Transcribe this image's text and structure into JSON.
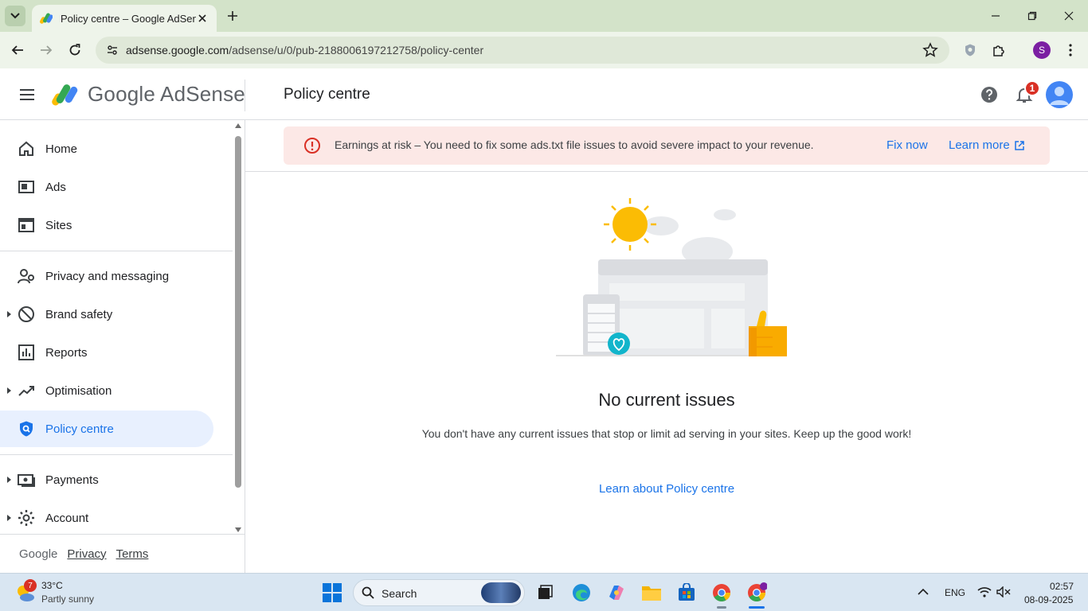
{
  "browser": {
    "tab_title": "Policy centre – Google AdSense",
    "url_host": "adsense.google.com",
    "url_path": "/adsense/u/0/pub-2188006197212758/policy-center",
    "profile_initial": "S"
  },
  "header": {
    "logo_text": "Google AdSense",
    "page_title": "Policy centre",
    "notification_count": "1"
  },
  "sidebar": {
    "items": [
      {
        "label": "Home",
        "icon": "home-icon"
      },
      {
        "label": "Ads",
        "icon": "ads-icon"
      },
      {
        "label": "Sites",
        "icon": "sites-icon"
      },
      {
        "label": "Privacy and messaging",
        "icon": "privacy-icon"
      },
      {
        "label": "Brand safety",
        "icon": "block-icon"
      },
      {
        "label": "Reports",
        "icon": "reports-icon"
      },
      {
        "label": "Optimisation",
        "icon": "trend-icon"
      },
      {
        "label": "Policy centre",
        "icon": "policy-shield-icon"
      },
      {
        "label": "Payments",
        "icon": "payments-icon"
      },
      {
        "label": "Account",
        "icon": "gear-icon"
      }
    ],
    "footer": {
      "google": "Google",
      "privacy": "Privacy",
      "terms": "Terms"
    }
  },
  "alert": {
    "text": "Earnings at risk – You need to fix some ads.txt file issues to avoid severe impact to your revenue.",
    "fix_label": "Fix now",
    "learn_label": "Learn more"
  },
  "empty_state": {
    "title": "No current issues",
    "description": "You don't have any current issues that stop or limit ad serving in your sites. Keep up the good work!",
    "link": "Learn about Policy centre"
  },
  "taskbar": {
    "weather_badge": "7",
    "temperature": "33°C",
    "condition": "Partly sunny",
    "search_label": "Search",
    "language": "ENG",
    "time": "02:57",
    "date": "08-09-2025"
  },
  "colors": {
    "accent": "#1a73e8",
    "alert_bg": "#fce8e6",
    "error": "#d93025",
    "active_nav_bg": "#e8f0fe"
  }
}
